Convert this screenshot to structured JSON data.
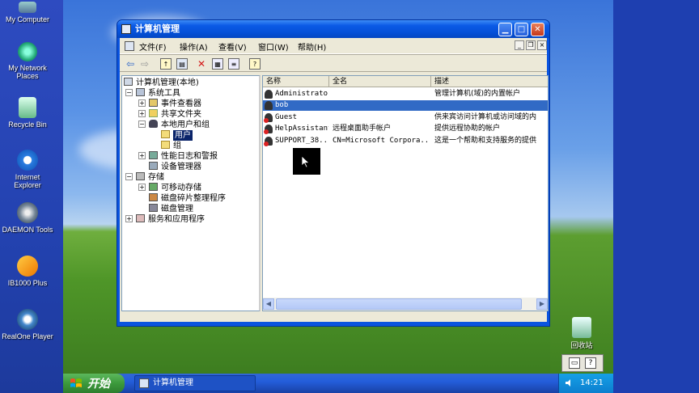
{
  "desktop": {
    "icons": [
      {
        "label": "My Computer",
        "icon": "my-computer-icon"
      },
      {
        "label": "My Network Places",
        "icon": "network-places-icon"
      },
      {
        "label": "Recycle Bin",
        "icon": "recycle-bin-icon"
      },
      {
        "label": "Internet Explorer",
        "icon": "internet-explorer-icon"
      },
      {
        "label": "DAEMON Tools",
        "icon": "daemon-tools-icon"
      },
      {
        "label": "IB1000 Plus",
        "icon": "ib1000-icon"
      },
      {
        "label": "RealOne Player",
        "icon": "realone-icon"
      }
    ],
    "recycle_label": "回收站"
  },
  "window": {
    "title": "计算机管理",
    "menu": [
      "文件(F)",
      "操作(A)",
      "查看(V)",
      "窗口(W)",
      "帮助(H)"
    ]
  },
  "tree": {
    "root": "计算机管理(本地)",
    "system_tools": "系统工具",
    "event_viewer": "事件查看器",
    "shared_folders": "共享文件夹",
    "local_users": "本地用户和组",
    "users": "用户",
    "groups": "组",
    "perf_logs": "性能日志和警报",
    "device_manager": "设备管理器",
    "storage": "存储",
    "removable": "可移动存储",
    "defrag": "磁盘碎片整理程序",
    "disk_mgmt": "磁盘管理",
    "services_apps": "服务和应用程序"
  },
  "list": {
    "columns": [
      "名称",
      "全名",
      "描述"
    ],
    "rows": [
      {
        "name": "Administrator",
        "fullname": "",
        "desc": "管理计算机(域)的内置帐户",
        "disabled": false,
        "selected": false
      },
      {
        "name": "bob",
        "fullname": "",
        "desc": "",
        "disabled": false,
        "selected": true
      },
      {
        "name": "Guest",
        "fullname": "",
        "desc": "供来宾访问计算机或访问域的内",
        "disabled": true,
        "selected": false
      },
      {
        "name": "HelpAssistant",
        "fullname": "远程桌面助手帐户",
        "desc": "提供远程协助的帐户",
        "disabled": true,
        "selected": false
      },
      {
        "name": "SUPPORT_38...",
        "fullname": "CN=Microsoft Corpora...",
        "desc": "这是一个帮助和支持服务的提供",
        "disabled": true,
        "selected": false
      }
    ]
  },
  "taskbar": {
    "start_label": "开始",
    "task_label": "计算机管理",
    "clock": "14:21"
  },
  "colors": {
    "title_blue": "#0550d8",
    "selection": "#316ac5",
    "start_green": "#3c9a3c"
  }
}
